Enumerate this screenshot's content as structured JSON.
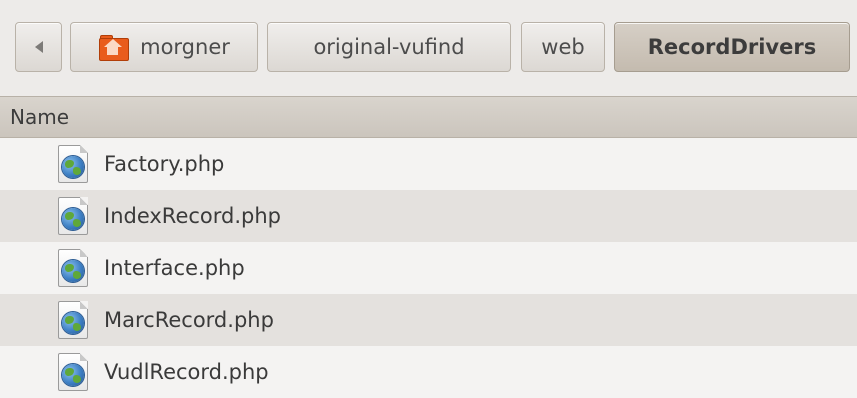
{
  "pathbar": {
    "back_icon": "left-arrow-icon",
    "home_icon": "home-folder-icon",
    "crumbs": [
      {
        "label": "morgner"
      },
      {
        "label": "original-vufind"
      },
      {
        "label": "web"
      },
      {
        "label": "RecordDrivers",
        "active": true
      }
    ]
  },
  "list": {
    "column_name": "Name",
    "file_icon": "php-globe-file-icon",
    "files": [
      {
        "name": "Factory.php"
      },
      {
        "name": "IndexRecord.php"
      },
      {
        "name": "Interface.php"
      },
      {
        "name": "MarcRecord.php"
      },
      {
        "name": "VudlRecord.php"
      }
    ]
  },
  "colors": {
    "active_crumb": "#c9c1b6",
    "home_folder": "#e95c1c",
    "row_alt": "#e4e1de"
  }
}
